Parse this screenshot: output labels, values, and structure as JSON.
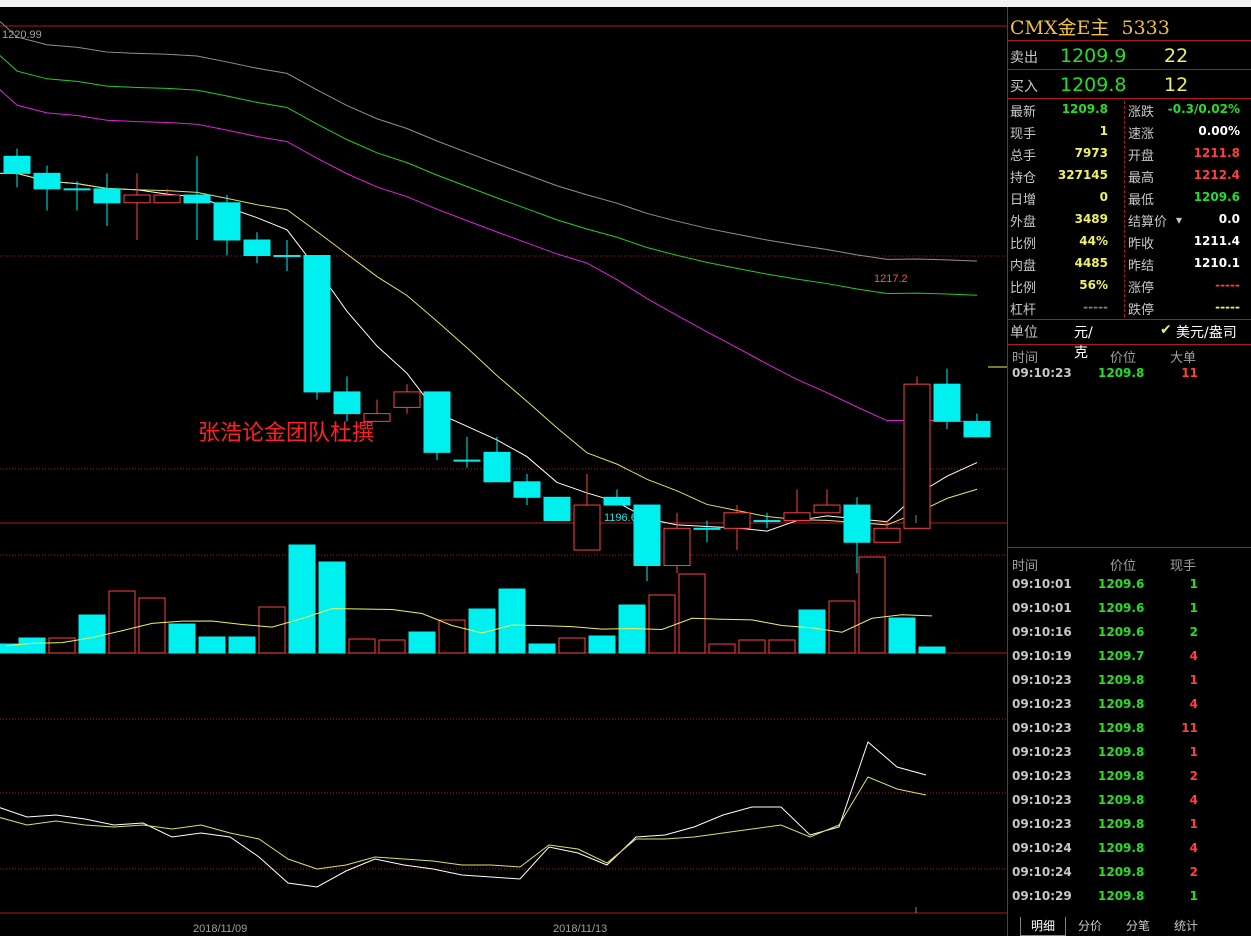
{
  "chart_data": {
    "type": "candlestick",
    "price_label": "1220.99",
    "high_label": "1217.2",
    "low_label": "1196.6",
    "annotation": "张浩论金团队杜撰",
    "dates": [
      "2018/11/09",
      "2018/11/13"
    ],
    "candles": [
      [
        1207.4,
        1206.3,
        1207.9,
        1205.4
      ],
      [
        1206.3,
        1205.3,
        1206.8,
        1203.9
      ],
      [
        1205.3,
        1205.3,
        1205.8,
        1203.9
      ],
      [
        1205.3,
        1204.4,
        1206.3,
        1202.9
      ],
      [
        1204.4,
        1204.9,
        1206.3,
        1202.0
      ],
      [
        1204.4,
        1204.9,
        1205.3,
        1204.4
      ],
      [
        1204.9,
        1204.4,
        1207.4,
        1202.0
      ],
      [
        1204.4,
        1202.0,
        1204.9,
        1201.0
      ],
      [
        1202.0,
        1201.0,
        1202.5,
        1200.5
      ],
      [
        1201.0,
        1201.0,
        1202.0,
        1200.0
      ],
      [
        1201.0,
        1192.2,
        1201.0,
        1191.7
      ],
      [
        1192.2,
        1190.8,
        1193.2,
        1190.3
      ],
      [
        1190.3,
        1190.8,
        1191.7,
        1190.3
      ],
      [
        1191.2,
        1192.2,
        1192.7,
        1190.8
      ],
      [
        1192.2,
        1188.3,
        1192.2,
        1187.8
      ],
      [
        1187.8,
        1187.8,
        1189.3,
        1187.3
      ],
      [
        1188.3,
        1186.4,
        1189.3,
        1186.4
      ],
      [
        1186.4,
        1185.4,
        1186.9,
        1184.9
      ],
      [
        1185.4,
        1183.9,
        1185.4,
        1183.9
      ],
      [
        1182.0,
        1184.9,
        1186.9,
        1182.0
      ],
      [
        1185.4,
        1184.9,
        1185.9,
        1184.9
      ],
      [
        1184.9,
        1181.0,
        1184.9,
        1180.0
      ],
      [
        1181.0,
        1183.4,
        1184.4,
        1180.5
      ],
      [
        1183.4,
        1183.4,
        1183.9,
        1182.5
      ],
      [
        1183.4,
        1184.4,
        1184.9,
        1182.0
      ],
      [
        1183.9,
        1183.9,
        1184.4,
        1183.4
      ],
      [
        1183.9,
        1184.4,
        1185.9,
        1183.9
      ],
      [
        1184.4,
        1184.9,
        1185.9,
        1184.4
      ],
      [
        1184.9,
        1182.5,
        1185.4,
        1180.5
      ],
      [
        1182.5,
        1183.4,
        1183.9,
        1182.5
      ],
      [
        1183.4,
        1192.7,
        1193.2,
        1183.4
      ],
      [
        1192.7,
        1190.3,
        1193.7,
        1189.8
      ],
      [
        1190.3,
        1189.3,
        1190.8,
        1189.3
      ]
    ],
    "volume_x": [
      6,
      32,
      62,
      92,
      122,
      152,
      182,
      212,
      242,
      272,
      302,
      332,
      362,
      392,
      422,
      452,
      482,
      512,
      542,
      572,
      602,
      632,
      662,
      692,
      722,
      752,
      782,
      812,
      842,
      872,
      902,
      932
    ],
    "volume": [
      9,
      15,
      15,
      38,
      62,
      55,
      29,
      16,
      16,
      46,
      108,
      91,
      14,
      13,
      21,
      33,
      44,
      64,
      9,
      15,
      17,
      48,
      58,
      79,
      9,
      13,
      13,
      43,
      52,
      96,
      35,
      6
    ],
    "volume_red": [
      false,
      false,
      true,
      false,
      true,
      true,
      false,
      false,
      false,
      true,
      false,
      false,
      true,
      true,
      false,
      true,
      false,
      false,
      false,
      true,
      false,
      false,
      true,
      true,
      true,
      true,
      true,
      false,
      true,
      true,
      false,
      false
    ]
  },
  "side": {
    "title": "CMX金E主",
    "code": "5333",
    "sell_label": "卖出",
    "sell_price": "1209.9",
    "sell_qty": "22",
    "buy_label": "买入",
    "buy_price": "1209.8",
    "buy_qty": "12",
    "stats": [
      {
        "l": "最新",
        "v": "1209.8",
        "vc": "g",
        "l2": "涨跌",
        "v2": "-0.3/0.02%",
        "vc2": "g"
      },
      {
        "l": "现手",
        "v": "1",
        "vc": "y",
        "l2": "速涨",
        "v2": "0.00%",
        "vc2": "w"
      },
      {
        "l": "总手",
        "v": "7973",
        "vc": "y",
        "l2": "开盘",
        "v2": "1211.8",
        "vc2": "r"
      },
      {
        "l": "持仓",
        "v": "327145",
        "vc": "y",
        "l2": "最高",
        "v2": "1212.4",
        "vc2": "r"
      },
      {
        "l": "日增",
        "v": "0",
        "vc": "y",
        "l2": "最低",
        "v2": "1209.6",
        "vc2": "g"
      },
      {
        "l": "外盘",
        "v": "3489",
        "vc": "y",
        "l2": "结算价",
        "v2": "0.0",
        "vc2": "w"
      },
      {
        "l": "比例",
        "v": "44%",
        "vc": "y",
        "l2": "昨收",
        "v2": "1211.4",
        "vc2": "w"
      },
      {
        "l": "内盘",
        "v": "4485",
        "vc": "y",
        "l2": "昨结",
        "v2": "1210.1",
        "vc2": "w"
      },
      {
        "l": "比例",
        "v": "56%",
        "vc": "y",
        "l2": "涨停",
        "v2": "-----",
        "vc2": "r"
      },
      {
        "l": "杠杆",
        "v": "-----",
        "vc": "gr",
        "l2": "跌停",
        "v2": "-----",
        "vc2": "y"
      }
    ],
    "unit_label": "单位",
    "unit_val": "元/克",
    "unit_opt": "美元/盎司",
    "big_header": [
      "时间",
      "价位",
      "大单"
    ],
    "big_rows": [
      [
        "09:10:23",
        "1209.8",
        "11"
      ]
    ],
    "tick_header": [
      "时间",
      "价位",
      "现手"
    ],
    "ticks": [
      [
        "09:10:01",
        "1209.6",
        "1",
        "g"
      ],
      [
        "09:10:01",
        "1209.6",
        "1",
        "g"
      ],
      [
        "09:10:16",
        "1209.6",
        "2",
        "g"
      ],
      [
        "09:10:19",
        "1209.7",
        "4",
        "r"
      ],
      [
        "09:10:23",
        "1209.8",
        "1",
        "r"
      ],
      [
        "09:10:23",
        "1209.8",
        "4",
        "r"
      ],
      [
        "09:10:23",
        "1209.8",
        "11",
        "r"
      ],
      [
        "09:10:23",
        "1209.8",
        "1",
        "r"
      ],
      [
        "09:10:23",
        "1209.8",
        "2",
        "r"
      ],
      [
        "09:10:23",
        "1209.8",
        "4",
        "r"
      ],
      [
        "09:10:23",
        "1209.8",
        "1",
        "r"
      ],
      [
        "09:10:24",
        "1209.8",
        "4",
        "r"
      ],
      [
        "09:10:24",
        "1209.8",
        "2",
        "r"
      ],
      [
        "09:10:29",
        "1209.8",
        "1",
        "g"
      ]
    ],
    "tabs": [
      "明细",
      "分价",
      "分笔",
      "统计"
    ]
  },
  "colors": {
    "up": "#ff4040",
    "down": "#00f0f0",
    "grid": "#b01818"
  }
}
